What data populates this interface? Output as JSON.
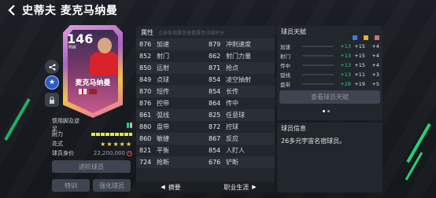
{
  "header": {
    "title": "史蒂夫 麦克马纳曼"
  },
  "card": {
    "rating": "146",
    "position": "RW",
    "name": "麦克马纳曼"
  },
  "info": {
    "preferred_foot_label": "惯用脚及逆足",
    "stamina_label": "耐力",
    "skills_label": "花式",
    "skills_stars": "★★★★★",
    "value_label": "球员身价",
    "value": "22,200,000"
  },
  "buttons": {
    "promote": "进阶球员",
    "trait": "特训",
    "train": "强化球员",
    "view_traits": "查看球员天赋"
  },
  "attributes": {
    "title": "属性",
    "hint": "点击各项属性查看属性详细评分",
    "left": [
      {
        "num": "876",
        "name": "加速"
      },
      {
        "num": "852",
        "name": "射门"
      },
      {
        "num": "850",
        "name": "远射"
      },
      {
        "num": "849",
        "name": "点球"
      },
      {
        "num": "870",
        "name": "短传"
      },
      {
        "num": "876",
        "name": "控带"
      },
      {
        "num": "861",
        "name": "弧线"
      },
      {
        "num": "880",
        "name": "盘带"
      },
      {
        "num": "860",
        "name": "敏捷"
      },
      {
        "num": "821",
        "name": "平衡"
      },
      {
        "num": "724",
        "name": "抢断"
      }
    ],
    "right": [
      {
        "num": "879",
        "name": "冲刺速度"
      },
      {
        "num": "862",
        "name": "射门力量"
      },
      {
        "num": "871",
        "name": "抢点"
      },
      {
        "num": "854",
        "name": "凌空抽射"
      },
      {
        "num": "854",
        "name": "长传"
      },
      {
        "num": "864",
        "name": "传中"
      },
      {
        "num": "825",
        "name": "任意球"
      },
      {
        "num": "872",
        "name": "控球"
      },
      {
        "num": "867",
        "name": "反应"
      },
      {
        "num": "854",
        "name": "人盯人"
      },
      {
        "num": "676",
        "name": "铲断"
      }
    ],
    "footer_left": "摘要",
    "footer_right": "职业生涯"
  },
  "traits": {
    "title": "球员天赋",
    "rows": [
      {
        "name": "加速",
        "a": "+13",
        "b": "+15",
        "c": "+4"
      },
      {
        "name": "射门",
        "a": "+13",
        "b": "+15",
        "c": "+4"
      },
      {
        "name": "传中",
        "a": "+13",
        "b": "+15",
        "c": "+4"
      },
      {
        "name": "弧线",
        "a": "+13",
        "b": "+11",
        "c": "+3"
      },
      {
        "name": "盘带",
        "a": "+28",
        "b": "+19",
        "c": "+5"
      }
    ]
  },
  "player_info": {
    "title": "球员信息",
    "text": "26多元宇宙名宿球员。"
  },
  "colors": {
    "accent": "#23d27a",
    "panel": "#22262d",
    "background": "#15181d"
  }
}
